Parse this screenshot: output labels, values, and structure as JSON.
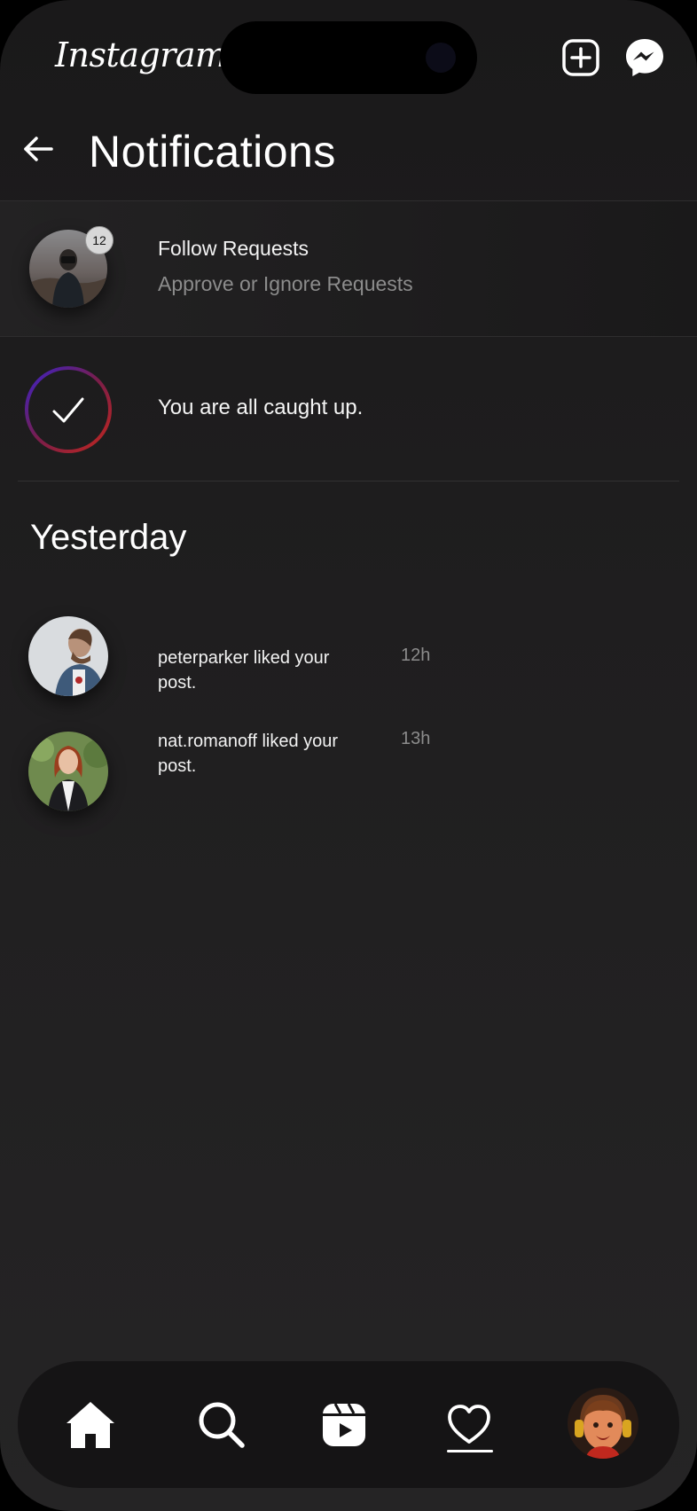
{
  "app": {
    "logo_text": "Instagram"
  },
  "header": {
    "title": "Notifications"
  },
  "follow_requests": {
    "badge_count": "12",
    "title": "Follow Requests",
    "subtitle": "Approve or Ignore Requests"
  },
  "caught_up": {
    "text": "You are all caught up."
  },
  "section": {
    "title": "Yesterday"
  },
  "notifications": [
    {
      "text": "peterparker liked your post.",
      "time": "12h"
    },
    {
      "text": "nat.romanoff liked your post.",
      "time": "13h"
    }
  ],
  "icons": {
    "top_add": "plus-square-icon",
    "top_messenger": "messenger-icon",
    "back": "arrow-left-icon",
    "check": "check-icon",
    "nav": [
      "home-icon",
      "search-icon",
      "reels-icon",
      "heart-icon",
      "profile-avatar"
    ]
  },
  "colors": {
    "background": "#1f1e1f",
    "text_primary": "#ffffff",
    "text_secondary": "#8c8c8c",
    "tabbar": "#151415"
  }
}
